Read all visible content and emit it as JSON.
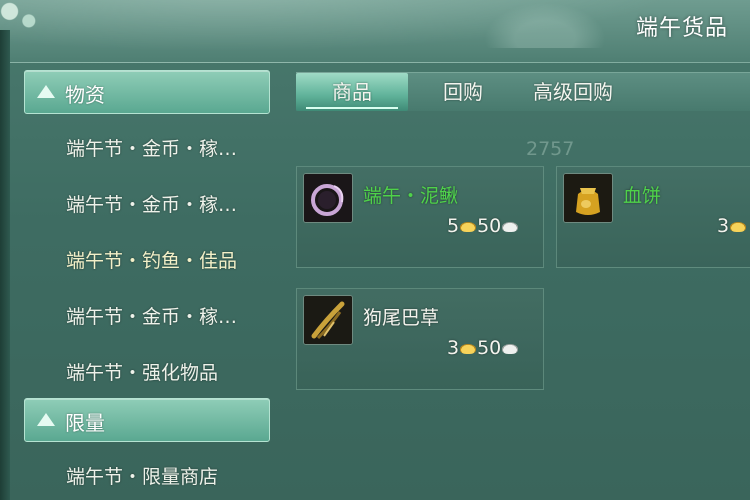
{
  "window": {
    "title": "端午货品"
  },
  "sidebar": {
    "categories": [
      {
        "label": "物资",
        "icon": "triangle-up-icon"
      },
      {
        "label": "限量",
        "icon": "triangle-up-icon"
      }
    ],
    "items": [
      {
        "label": "端午节・金币・稼…",
        "selected": false
      },
      {
        "label": "端午节・金币・稼…",
        "selected": false
      },
      {
        "label": "端午节・钓鱼・佳品",
        "selected": true
      },
      {
        "label": "端午节・金币・稼…",
        "selected": false
      },
      {
        "label": "端午节・强化物品",
        "selected": false
      },
      {
        "label": "端午节・限量商店",
        "selected": false
      }
    ]
  },
  "tabs": [
    {
      "label": "商品",
      "active": true
    },
    {
      "label": "回购",
      "active": false
    },
    {
      "label": "高级回购",
      "active": false
    }
  ],
  "currency_hint": "2757",
  "goods": [
    {
      "name": "端午・泥鳅",
      "name_color": "#4fd24a",
      "icon": "purple-ring-icon",
      "price_gold": "5",
      "price_silver": "50"
    },
    {
      "name": "血饼",
      "name_color": "#4fd24a",
      "icon": "gold-pouch-icon",
      "price_gold": "3",
      "price_silver": ""
    },
    {
      "name": "狗尾巴草",
      "name_color": "#f4f4ee",
      "icon": "foxtail-grass-icon",
      "price_gold": "3",
      "price_silver": "50"
    }
  ],
  "colors": {
    "accent": "#5fb299",
    "green_name": "#4fd24a",
    "panel_bg": "#3e6c62"
  }
}
